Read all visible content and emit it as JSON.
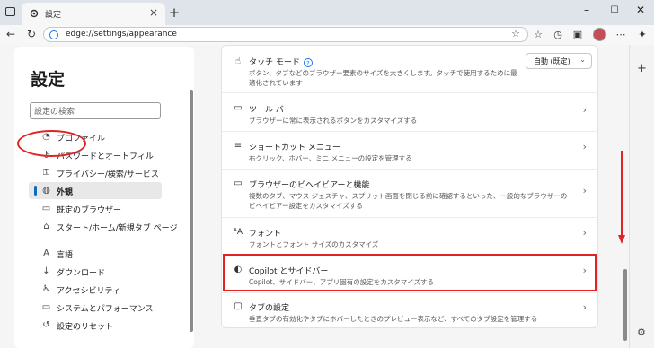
{
  "browser": {
    "tab_title": "設定",
    "url": "edge://settings/appearance"
  },
  "sidebar": {
    "title": "設定",
    "search_placeholder": "設定の検索",
    "items": [
      {
        "label": "プロファイル",
        "icon": "profile-icon"
      },
      {
        "label": "パスワードとオートフィル",
        "icon": "key-icon"
      },
      {
        "label": "プライバシー/検索/サービス",
        "icon": "lock-icon"
      },
      {
        "label": "外観",
        "icon": "appearance-icon",
        "active": true
      },
      {
        "label": "既定のブラウザー",
        "icon": "browser-icon"
      },
      {
        "label": "スタート/ホーム/新規タブ ページ",
        "icon": "home-icon"
      },
      {
        "label": "言語",
        "icon": "language-icon"
      },
      {
        "label": "ダウンロード",
        "icon": "download-icon"
      },
      {
        "label": "アクセシビリティ",
        "icon": "accessibility-icon"
      },
      {
        "label": "システムとパフォーマンス",
        "icon": "system-icon"
      },
      {
        "label": "設定のリセット",
        "icon": "reset-icon"
      }
    ]
  },
  "settings": [
    {
      "title": "タッチ モード",
      "desc": "ボタン、タブなどのブラウザー要素のサイズを大きくします。タッチで使用するために最適化されています",
      "control": "自動 (既定)",
      "icon": "touch-icon"
    },
    {
      "title": "ツール バー",
      "desc": "ブラウザーに常に表示されるボタンをカスタマイズする",
      "icon": "toolbar-icon"
    },
    {
      "title": "ショートカット メニュー",
      "desc": "右クリック、ホバー、ミニ メニューの設定を管理する",
      "icon": "menu-icon"
    },
    {
      "title": "ブラウザーのビヘイビアーと機能",
      "desc": "複数のタブ、マウス ジェスチャ、スプリット画面を閉じる前に確認するといった、一般的なブラウザーのビヘイビアー設定をカスタマイズする",
      "icon": "browser-behavior-icon"
    },
    {
      "title": "フォント",
      "desc": "フォントとフォント サイズのカスタマイズ",
      "icon": "font-icon"
    },
    {
      "title": "Copilot とサイドバー",
      "desc": "Copilot、サイドバー、アプリ固有の設定をカスタマイズする",
      "icon": "copilot-icon"
    },
    {
      "title": "タブの設定",
      "desc": "垂直タブの有効化やタブにホバーしたときのプレビュー表示など、すべてのタブ設定を管理する",
      "icon": "tab-icon"
    }
  ],
  "colors": {
    "highlight": "#e02424",
    "accent": "#0f6cbd"
  }
}
